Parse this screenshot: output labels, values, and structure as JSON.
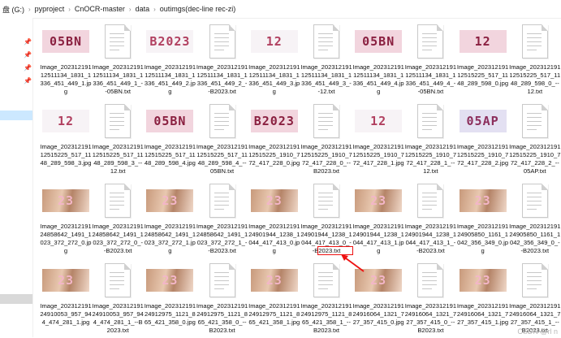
{
  "breadcrumb": {
    "items": [
      "盘 (G:)",
      "pyproject",
      "CnOCR-master",
      "data",
      "outimgs(dec-line  rec-zi)"
    ],
    "separator": "›"
  },
  "highlight": {
    "color": "#ee1111"
  },
  "watermark": "CSDN @rl n",
  "files": [
    {
      "name": "Image_20231219112511134_1831_1336_451_449_1.jpg",
      "kind": "image",
      "text": "05BN",
      "style": "pink"
    },
    {
      "name": "Image_20231219112511134_1831_1336_451_449_1_--05BN.txt",
      "kind": "text"
    },
    {
      "name": "Image_20231219112511134_1831_1336_451_449_2.jpg",
      "kind": "image",
      "text": "B2023",
      "style": "light"
    },
    {
      "name": "Image_20231219112511134_1831_1336_451_449_2_--B2023.txt",
      "kind": "text"
    },
    {
      "name": "Image_20231219112511134_1831_1336_451_449_3.jpg",
      "kind": "image",
      "text": "12",
      "style": "light"
    },
    {
      "name": "Image_20231219112511134_1831_1336_451_449_3_--12.txt",
      "kind": "text"
    },
    {
      "name": "Image_20231219112511134_1831_1336_451_449_4.jpg",
      "kind": "image",
      "text": "05BN",
      "style": "pink"
    },
    {
      "name": "Image_20231219112511134_1831_1336_451_449_4_--05BN.txt",
      "kind": "text"
    },
    {
      "name": "Image_20231219112515225_517_1148_289_598_0.jpg",
      "kind": "image",
      "text": "12",
      "style": "pink"
    },
    {
      "name": "Image_20231219112515225_517_1148_289_598_0_--12.txt",
      "kind": "text"
    },
    {
      "name": "Image_20231219112515225_517_1148_289_598_3.jpg",
      "kind": "image",
      "text": "12",
      "style": "light"
    },
    {
      "name": "Image_20231219112515225_517_1148_289_598_3_--12.txt",
      "kind": "text"
    },
    {
      "name": "Image_20231219112515225_517_1148_289_598_4.jpg",
      "kind": "image",
      "text": "05BN",
      "style": "pink"
    },
    {
      "name": "Image_20231219112515225_517_1148_289_598_4_--05BN.txt",
      "kind": "text"
    },
    {
      "name": "Image_20231219112515225_1910_772_417_228_0.jpg",
      "kind": "image",
      "text": "B2023",
      "style": "pink"
    },
    {
      "name": "Image_20231219112515225_1910_772_417_228_0_--B2023.txt",
      "kind": "text"
    },
    {
      "name": "Image_20231219112515225_1910_772_417_228_1.jpg",
      "kind": "image",
      "text": "12",
      "style": "light"
    },
    {
      "name": "Image_20231219112515225_1910_772_417_228_1_--12.txt",
      "kind": "text"
    },
    {
      "name": "Image_20231219112515225_1910_772_417_228_2.jpg",
      "kind": "image",
      "text": "05AP",
      "style": "blue"
    },
    {
      "name": "Image_20231219112515225_1910_772_417_228_2_--05AP.txt",
      "kind": "text"
    },
    {
      "name": "Image_20231219124858642_1491_1023_372_272_0.jpg",
      "kind": "image",
      "text": "23",
      "style": "swirl"
    },
    {
      "name": "Image_20231219124858642_1491_1023_372_272_0_--B2023.txt",
      "kind": "text"
    },
    {
      "name": "Image_20231219124858642_1491_1023_372_272_1.jpg",
      "kind": "image",
      "text": "23",
      "style": "swirl"
    },
    {
      "name": "Image_20231219124858642_1491_1023_372_272_1_--B2023.txt",
      "kind": "text"
    },
    {
      "name": "Image_20231219124901944_1238_1044_417_413_0.jpg",
      "kind": "image",
      "text": "23",
      "style": "swirl"
    },
    {
      "name": "Image_20231219124901944_1238_1044_417_413_0_--B2023.txt",
      "kind": "text"
    },
    {
      "name": "Image_20231219124901944_1238_1044_417_413_1.jpg",
      "kind": "image",
      "text": "23",
      "style": "swirl"
    },
    {
      "name": "Image_20231219124901944_1238_1044_417_413_1_--B2023.txt",
      "kind": "text"
    },
    {
      "name": "Image_20231219124905850_1161_1042_356_349_0.jpg",
      "kind": "image",
      "text": "23",
      "style": "swirl"
    },
    {
      "name": "Image_20231219124905850_1161_1042_356_349_0_--B2023.txt",
      "kind": "text"
    },
    {
      "name": "Image_20231219124910053_957_944_474_281_1.jpg",
      "kind": "image",
      "text": "23",
      "style": "swirl"
    },
    {
      "name": "Image_20231219124910053_957_944_474_281_1_--B2023.txt",
      "kind": "text"
    },
    {
      "name": "Image_20231219124912975_1121_865_421_358_0.jpg",
      "kind": "image",
      "text": "23",
      "style": "swirl"
    },
    {
      "name": "Image_20231219124912975_1121_865_421_358_0_--B2023.txt",
      "kind": "text"
    },
    {
      "name": "Image_20231219124912975_1121_865_421_358_1.jpg",
      "kind": "image",
      "text": "23",
      "style": "swirl"
    },
    {
      "name": "Image_20231219124912975_1121_865_421_358_1_--B2023.txt",
      "kind": "text"
    },
    {
      "name": "Image_20231219124916064_1321_727_357_415_0.jpg",
      "kind": "image",
      "text": "23",
      "style": "swirl"
    },
    {
      "name": "Image_20231219124916064_1321_727_357_415_0_--B2023.txt",
      "kind": "text"
    },
    {
      "name": "Image_20231219124916064_1321_727_357_415_1.jpg",
      "kind": "image",
      "text": "23",
      "style": "swirl"
    },
    {
      "name": "Image_20231219124916064_1321_727_357_415_1_--B2023.txt",
      "kind": "text"
    }
  ]
}
